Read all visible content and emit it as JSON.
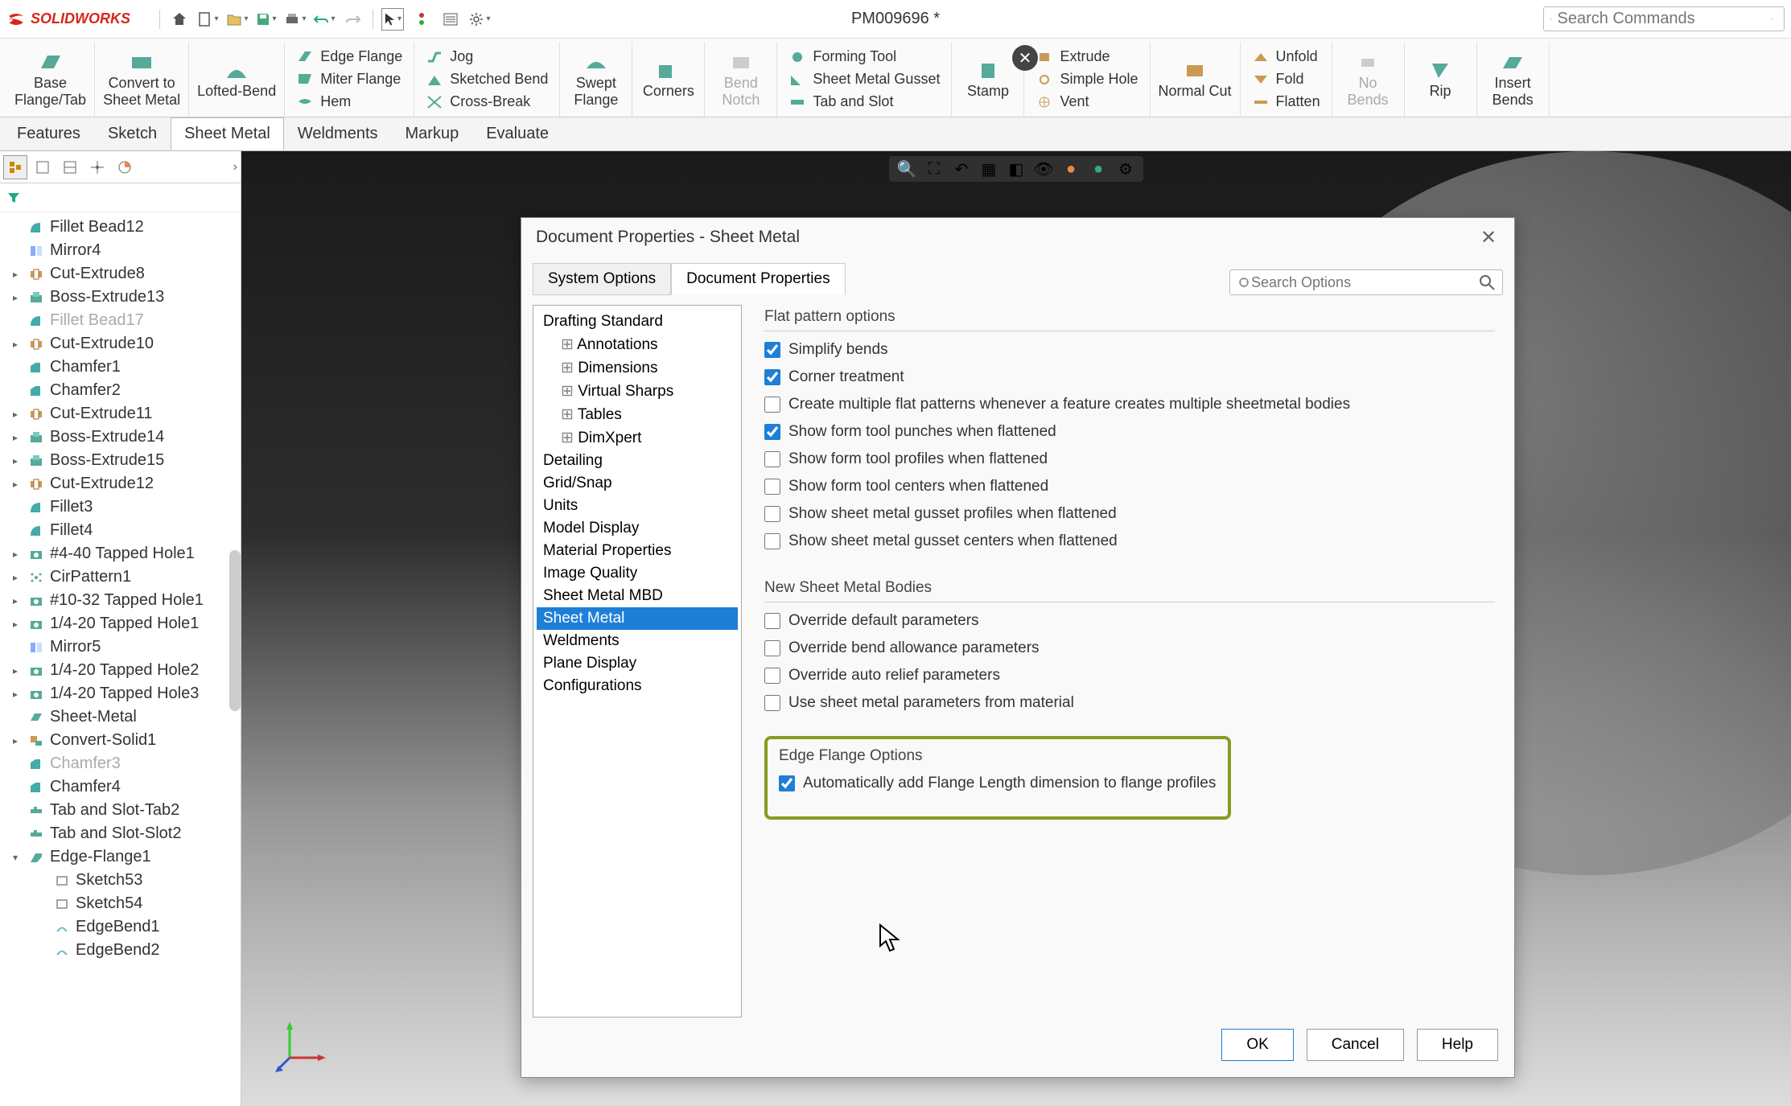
{
  "app": {
    "name": "SOLIDWORKS",
    "doc_title": "PM009696 *"
  },
  "search": {
    "placeholder": "Search Commands"
  },
  "ribbon": {
    "big": [
      {
        "label": "Base\nFlange/Tab"
      },
      {
        "label": "Convert to\nSheet Metal"
      },
      {
        "label": "Lofted-Bend"
      }
    ],
    "col1": [
      {
        "label": "Edge Flange"
      },
      {
        "label": "Miter Flange"
      },
      {
        "label": "Hem"
      }
    ],
    "col2": [
      {
        "label": "Jog"
      },
      {
        "label": "Sketched Bend"
      },
      {
        "label": "Cross-Break"
      }
    ],
    "big2": [
      {
        "label": "Swept\nFlange"
      },
      {
        "label": "Corners"
      },
      {
        "label": "Bend\nNotch",
        "dim": true
      }
    ],
    "col3": [
      {
        "label": "Forming Tool"
      },
      {
        "label": "Sheet Metal Gusset"
      },
      {
        "label": "Tab and Slot"
      }
    ],
    "stamp": {
      "label": "Stamp"
    },
    "col4": [
      {
        "label": "Extrude"
      },
      {
        "label": "Simple Hole"
      },
      {
        "label": "Vent"
      }
    ],
    "normal_cut": {
      "label": "Normal Cut"
    },
    "col5": [
      {
        "label": "Unfold"
      },
      {
        "label": "Fold"
      },
      {
        "label": "Flatten"
      }
    ],
    "nobends": {
      "label": "No\nBends",
      "dim": true
    },
    "rip": {
      "label": "Rip"
    },
    "insert_bends": {
      "label": "Insert\nBends"
    }
  },
  "feature_tabs": [
    "Features",
    "Sketch",
    "Sheet Metal",
    "Weldments",
    "Markup",
    "Evaluate"
  ],
  "active_feature_tab": 2,
  "tree": [
    {
      "label": "Fillet Bead12",
      "icon": "fillet",
      "exp": ""
    },
    {
      "label": "Mirror4",
      "icon": "mirror",
      "exp": ""
    },
    {
      "label": "Cut-Extrude8",
      "icon": "cut",
      "exp": "▸"
    },
    {
      "label": "Boss-Extrude13",
      "icon": "boss",
      "exp": "▸"
    },
    {
      "label": "Fillet Bead17",
      "icon": "fillet",
      "grey": true,
      "exp": ""
    },
    {
      "label": "Cut-Extrude10",
      "icon": "cut",
      "exp": "▸"
    },
    {
      "label": "Chamfer1",
      "icon": "chamfer",
      "exp": ""
    },
    {
      "label": "Chamfer2",
      "icon": "chamfer",
      "exp": ""
    },
    {
      "label": "Cut-Extrude11",
      "icon": "cut",
      "exp": "▸"
    },
    {
      "label": "Boss-Extrude14",
      "icon": "boss",
      "exp": "▸"
    },
    {
      "label": "Boss-Extrude15",
      "icon": "boss",
      "exp": "▸"
    },
    {
      "label": "Cut-Extrude12",
      "icon": "cut",
      "exp": "▸"
    },
    {
      "label": "Fillet3",
      "icon": "fillet",
      "exp": ""
    },
    {
      "label": "Fillet4",
      "icon": "fillet",
      "exp": ""
    },
    {
      "label": "#4-40 Tapped Hole1",
      "icon": "hole",
      "exp": "▸"
    },
    {
      "label": "CirPattern1",
      "icon": "pattern",
      "exp": "▸"
    },
    {
      "label": "#10-32 Tapped Hole1",
      "icon": "hole",
      "exp": "▸"
    },
    {
      "label": "1/4-20 Tapped Hole1",
      "icon": "hole",
      "exp": "▸"
    },
    {
      "label": "Mirror5",
      "icon": "mirror",
      "exp": ""
    },
    {
      "label": "1/4-20 Tapped Hole2",
      "icon": "hole",
      "exp": "▸"
    },
    {
      "label": "1/4-20 Tapped Hole3",
      "icon": "hole",
      "exp": "▸"
    },
    {
      "label": "Sheet-Metal",
      "icon": "sheet",
      "exp": ""
    },
    {
      "label": "Convert-Solid1",
      "icon": "convert",
      "exp": "▸"
    },
    {
      "label": "Chamfer3",
      "icon": "chamfer",
      "grey": true,
      "exp": ""
    },
    {
      "label": "Chamfer4",
      "icon": "chamfer",
      "exp": ""
    },
    {
      "label": "Tab and Slot-Tab2",
      "icon": "tab",
      "exp": ""
    },
    {
      "label": "Tab and Slot-Slot2",
      "icon": "tab",
      "exp": ""
    },
    {
      "label": "Edge-Flange1",
      "icon": "flange",
      "exp": "▾"
    },
    {
      "label": "Sketch53",
      "icon": "sketch",
      "child": true
    },
    {
      "label": "Sketch54",
      "icon": "sketch",
      "child": true
    },
    {
      "label": "EdgeBend1",
      "icon": "bend",
      "child": true
    },
    {
      "label": "EdgeBend2",
      "icon": "bend",
      "child": true
    }
  ],
  "dialog": {
    "title": "Document Properties - Sheet Metal",
    "tabs": [
      "System Options",
      "Document Properties"
    ],
    "active_tab": 1,
    "search_placeholder": "Search Options",
    "nav": [
      {
        "label": "Drafting Standard"
      },
      {
        "label": "Annotations",
        "indent": true
      },
      {
        "label": "Dimensions",
        "indent": true
      },
      {
        "label": "Virtual Sharps",
        "indent": true
      },
      {
        "label": "Tables",
        "indent": true
      },
      {
        "label": "DimXpert",
        "indent": true
      },
      {
        "label": "Detailing"
      },
      {
        "label": "Grid/Snap"
      },
      {
        "label": "Units"
      },
      {
        "label": "Model Display"
      },
      {
        "label": "Material Properties"
      },
      {
        "label": "Image Quality"
      },
      {
        "label": "Sheet Metal MBD"
      },
      {
        "label": "Sheet Metal",
        "selected": true
      },
      {
        "label": "Weldments"
      },
      {
        "label": "Plane Display"
      },
      {
        "label": "Configurations"
      }
    ],
    "group1_label": "Flat pattern options",
    "group1": [
      {
        "label": "Simplify bends",
        "checked": true
      },
      {
        "label": "Corner treatment",
        "checked": true
      },
      {
        "label": "Create multiple flat patterns whenever a feature creates multiple sheetmetal bodies",
        "checked": false
      },
      {
        "label": "Show form tool punches when flattened",
        "checked": true
      },
      {
        "label": "Show form tool profiles when flattened",
        "checked": false
      },
      {
        "label": "Show form tool centers when flattened",
        "checked": false
      },
      {
        "label": "Show sheet metal gusset profiles when flattened",
        "checked": false
      },
      {
        "label": "Show sheet metal gusset centers when flattened",
        "checked": false
      }
    ],
    "group2_label": "New Sheet Metal Bodies",
    "group2": [
      {
        "label": "Override default parameters",
        "checked": false
      },
      {
        "label": "Override bend allowance parameters",
        "checked": false
      },
      {
        "label": "Override auto relief parameters",
        "checked": false
      },
      {
        "label": "Use sheet metal parameters from material",
        "checked": false
      }
    ],
    "group3_label": "Edge Flange Options",
    "group3": [
      {
        "label": "Automatically add Flange Length dimension to flange profiles",
        "checked": true
      }
    ],
    "buttons": {
      "ok": "OK",
      "cancel": "Cancel",
      "help": "Help"
    }
  }
}
